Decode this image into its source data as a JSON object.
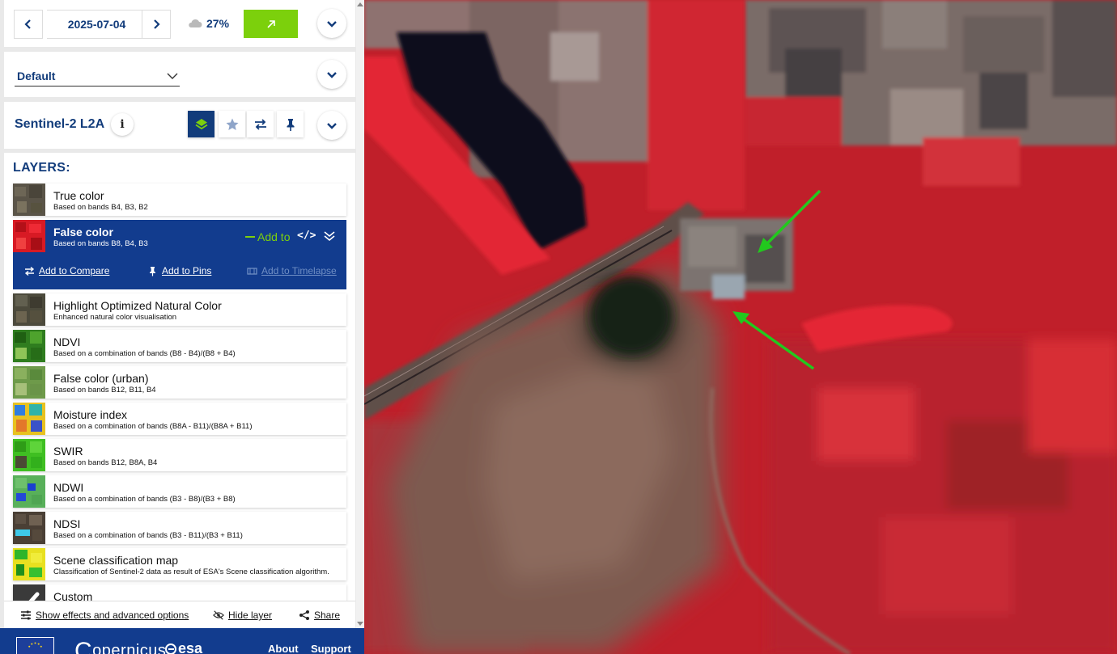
{
  "date": {
    "value": "2025-07-04"
  },
  "cloud": {
    "value": "27%"
  },
  "theme": {
    "value": "Default"
  },
  "dataset": {
    "title": "Sentinel-2 L2A",
    "info_label": "i"
  },
  "layers": {
    "heading": "LAYERS:",
    "active": {
      "name": "False color",
      "description": "Based on bands B8, B4, B3",
      "add_to_label": "Add to",
      "code_label": "</>",
      "actions": {
        "compare": "Add to Compare",
        "pins": "Add to Pins",
        "timelapse": "Add to Timelapse"
      }
    },
    "items": [
      {
        "name": "True color",
        "description": "Based on bands B4, B3, B2"
      },
      {
        "name": "Highlight Optimized Natural Color",
        "description": "Enhanced natural color visualisation"
      },
      {
        "name": "NDVI",
        "description": "Based on a combination of bands (B8 - B4)/(B8 + B4)"
      },
      {
        "name": "False color (urban)",
        "description": "Based on bands B12, B11, B4"
      },
      {
        "name": "Moisture index",
        "description": "Based on a combination of bands (B8A - B11)/(B8A + B11)"
      },
      {
        "name": "SWIR",
        "description": "Based on bands B12, B8A, B4"
      },
      {
        "name": "NDWI",
        "description": "Based on a combination of bands (B3 - B8)/(B3 + B8)"
      },
      {
        "name": "NDSI",
        "description": "Based on a combination of bands (B3 - B11)/(B3 + B11)"
      },
      {
        "name": "Scene classification map",
        "description": "Classification of Sentinel-2 data as result of ESA's Scene classification algorithm."
      },
      {
        "name": "Custom",
        "description": ""
      }
    ]
  },
  "options": {
    "effects": "Show effects and advanced options",
    "hide": "Hide layer",
    "share": "Share"
  },
  "footer": {
    "copernicus": "opernicus",
    "esa": "esa",
    "about": "About",
    "support": "Support"
  },
  "colors": {
    "primary": "#123c8e",
    "accent_green": "#7cd00c",
    "text_blue": "#123c7b",
    "arrow_green": "#22c81e"
  }
}
